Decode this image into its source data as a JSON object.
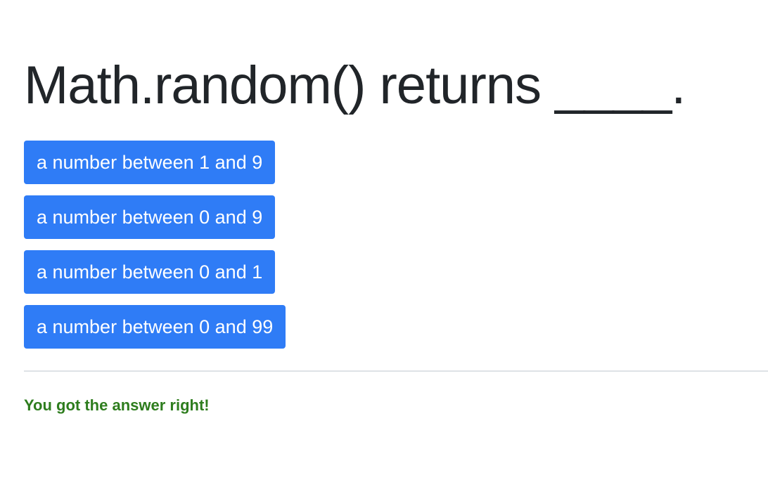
{
  "question": {
    "text": "Math.random() returns ____."
  },
  "answers": [
    {
      "label": "a number between 1 and 9"
    },
    {
      "label": "a number between 0 and 9"
    },
    {
      "label": "a number between 0 and 1"
    },
    {
      "label": "a number between 0 and 99"
    }
  ],
  "feedback": {
    "text": "You got the answer right!"
  },
  "colors": {
    "button_bg": "#2f7cf6",
    "button_text": "#ffffff",
    "heading_text": "#212529",
    "success_text": "#2e7d1e",
    "divider": "#dee2e6"
  }
}
